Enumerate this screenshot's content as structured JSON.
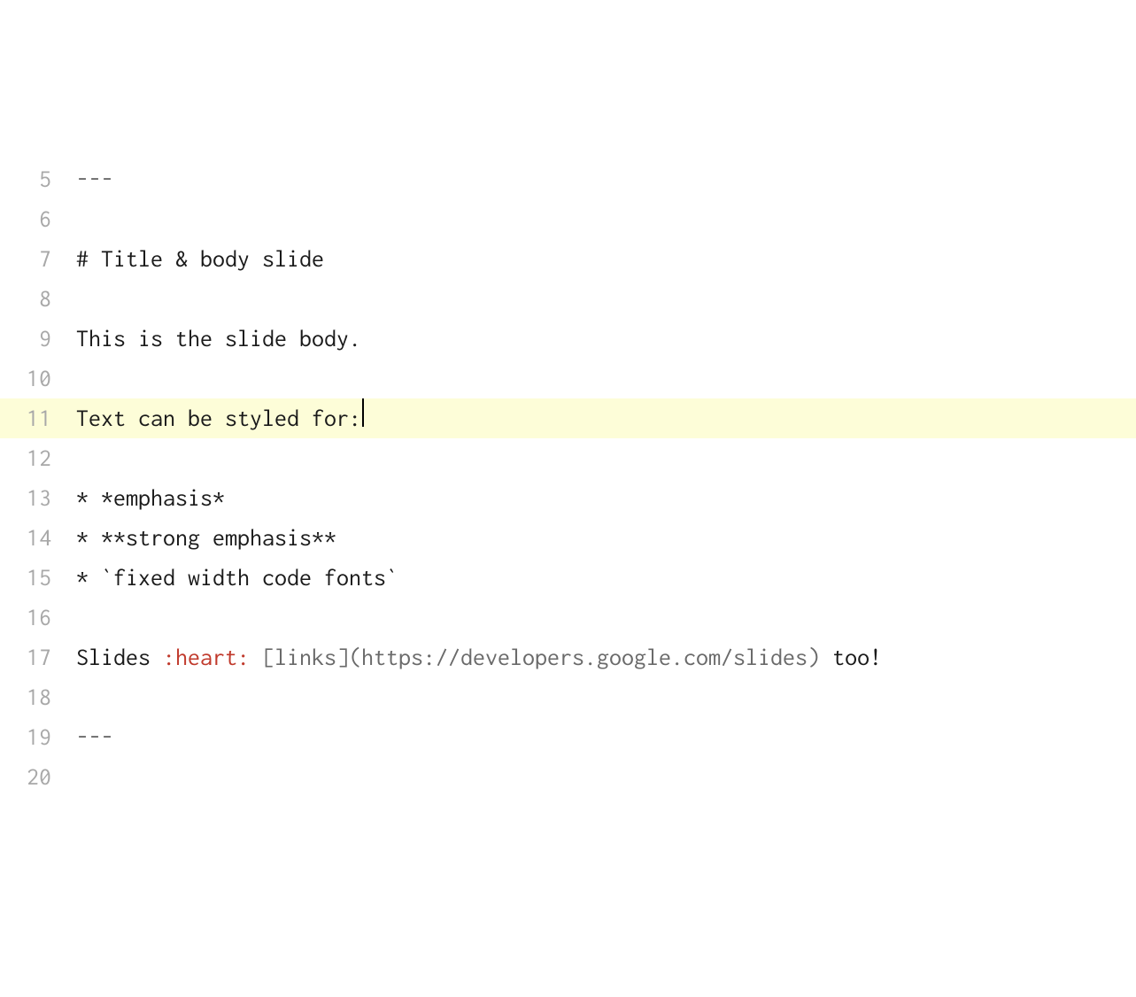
{
  "editor": {
    "startLine": 5,
    "activeLine": 11,
    "lines": [
      {
        "num": 5,
        "tokens": [
          {
            "t": "---",
            "c": "punc"
          }
        ]
      },
      {
        "num": 6,
        "tokens": []
      },
      {
        "num": 7,
        "tokens": [
          {
            "t": "# Title & body slide",
            "c": "default"
          }
        ]
      },
      {
        "num": 8,
        "tokens": []
      },
      {
        "num": 9,
        "tokens": [
          {
            "t": "This is the slide body.",
            "c": "default"
          }
        ]
      },
      {
        "num": 10,
        "tokens": []
      },
      {
        "num": 11,
        "tokens": [
          {
            "t": "Text can be styled for:",
            "c": "default"
          }
        ],
        "cursor": true
      },
      {
        "num": 12,
        "tokens": []
      },
      {
        "num": 13,
        "tokens": [
          {
            "t": "* *emphasis*",
            "c": "default"
          }
        ]
      },
      {
        "num": 14,
        "tokens": [
          {
            "t": "* **strong emphasis**",
            "c": "default"
          }
        ]
      },
      {
        "num": 15,
        "tokens": [
          {
            "t": "* `fixed width code fonts`",
            "c": "default"
          }
        ]
      },
      {
        "num": 16,
        "tokens": []
      },
      {
        "num": 17,
        "tokens": [
          {
            "t": "Slides ",
            "c": "default"
          },
          {
            "t": ":heart:",
            "c": "emoji"
          },
          {
            "t": " ",
            "c": "default"
          },
          {
            "t": "[links](https://developers.google.com/slides)",
            "c": "link"
          },
          {
            "t": " too!",
            "c": "default"
          }
        ]
      },
      {
        "num": 18,
        "tokens": []
      },
      {
        "num": 19,
        "tokens": [
          {
            "t": "---",
            "c": "punc"
          }
        ]
      },
      {
        "num": 20,
        "tokens": []
      }
    ]
  }
}
